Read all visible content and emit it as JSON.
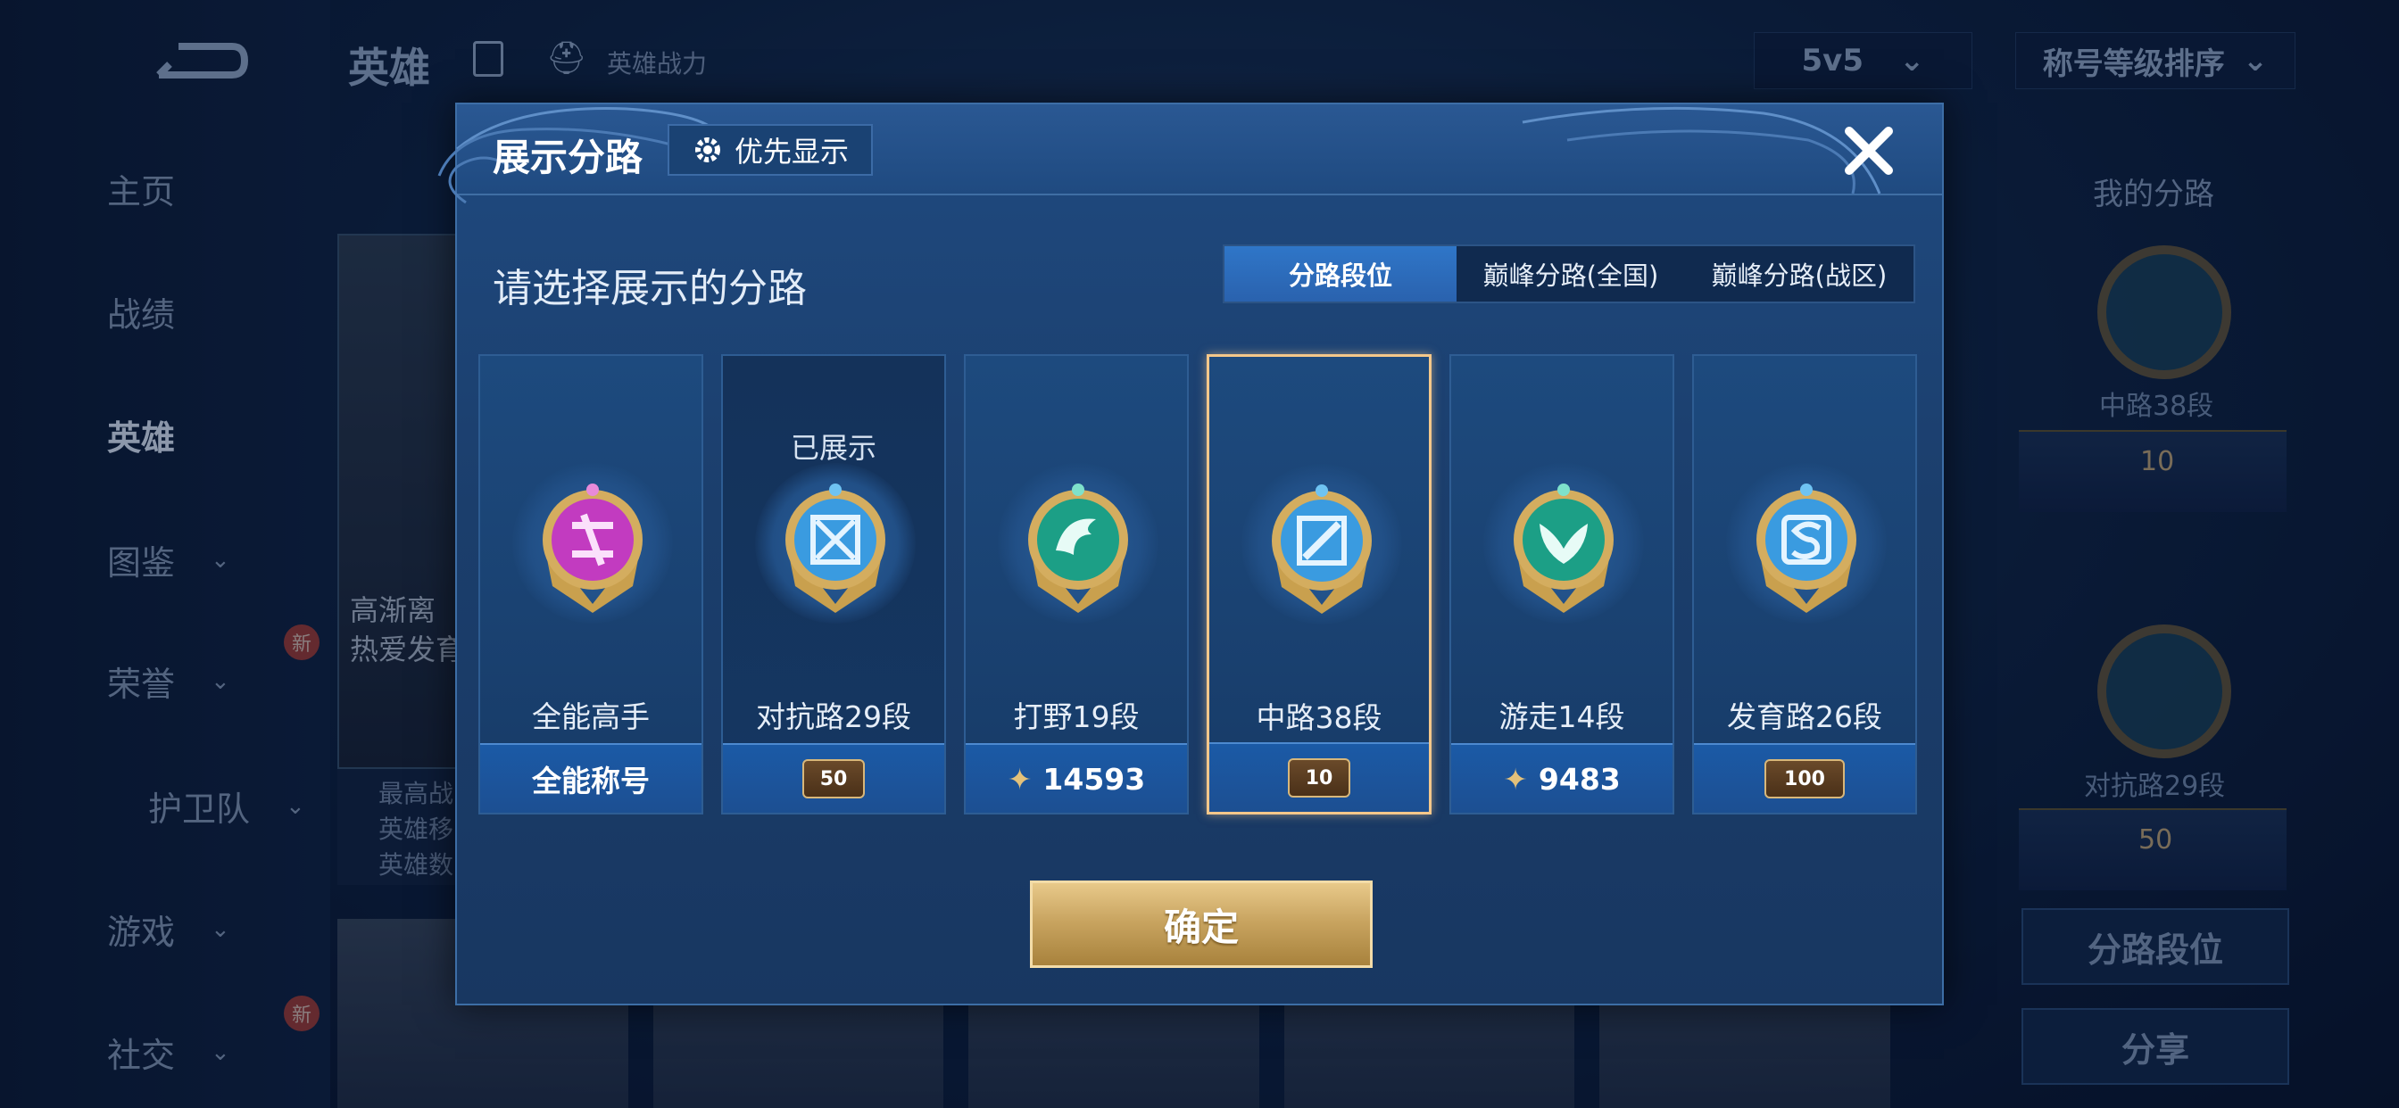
{
  "background": {
    "top_title": "英雄",
    "hero_power": "英雄战力",
    "mode_dropdown": "5v5",
    "sort_dropdown": "称号等级排序",
    "nav": [
      {
        "label": "主页"
      },
      {
        "label": "战绩"
      },
      {
        "label": "英雄"
      },
      {
        "label": "图鉴"
      },
      {
        "label": "荣誉"
      },
      {
        "label": "护卫队"
      },
      {
        "label": "游戏"
      },
      {
        "label": "社交"
      }
    ],
    "new_badge": "新",
    "hero_name_line1": "高渐离",
    "hero_name_line2": "热爱发育",
    "hero_info": [
      "最高战",
      "英雄移",
      "英雄数"
    ],
    "right_panel": {
      "title": "我的分路",
      "lane1": "中路38段",
      "lane1_rank": "10",
      "lane2": "对抗路29段",
      "lane2_rank": "50",
      "btn_lane_rank": "分路段位",
      "btn_share": "分享"
    }
  },
  "modal": {
    "title": "展示分路",
    "priority_label": "优先显示",
    "subtitle": "请选择展示的分路",
    "tabs": [
      {
        "label": "分路段位",
        "active": true
      },
      {
        "label": "巅峰分路(全国)",
        "active": false
      },
      {
        "label": "巅峰分路(战区)",
        "active": false
      }
    ],
    "cards": [
      {
        "name": "全能高手",
        "bottom": "全能称号",
        "medal_color": "#c23bc0",
        "icon": "all-round-medal-icon"
      },
      {
        "name": "对抗路29段",
        "shown": "已展示",
        "rank": "50",
        "medal_color": "#3a9be0",
        "icon": "clash-lane-medal-icon"
      },
      {
        "name": "打野19段",
        "score": "14593",
        "medal_color": "#1c9f86",
        "icon": "jungle-medal-icon"
      },
      {
        "name": "中路38段",
        "rank": "10",
        "medal_color": "#3a9be0",
        "icon": "mid-lane-medal-icon",
        "selected": true
      },
      {
        "name": "游走14段",
        "score": "9483",
        "medal_color": "#1c9f86",
        "icon": "roam-medal-icon"
      },
      {
        "name": "发育路26段",
        "rank": "100",
        "medal_color": "#3a9be0",
        "icon": "farm-lane-medal-icon"
      }
    ],
    "confirm_label": "确定"
  }
}
